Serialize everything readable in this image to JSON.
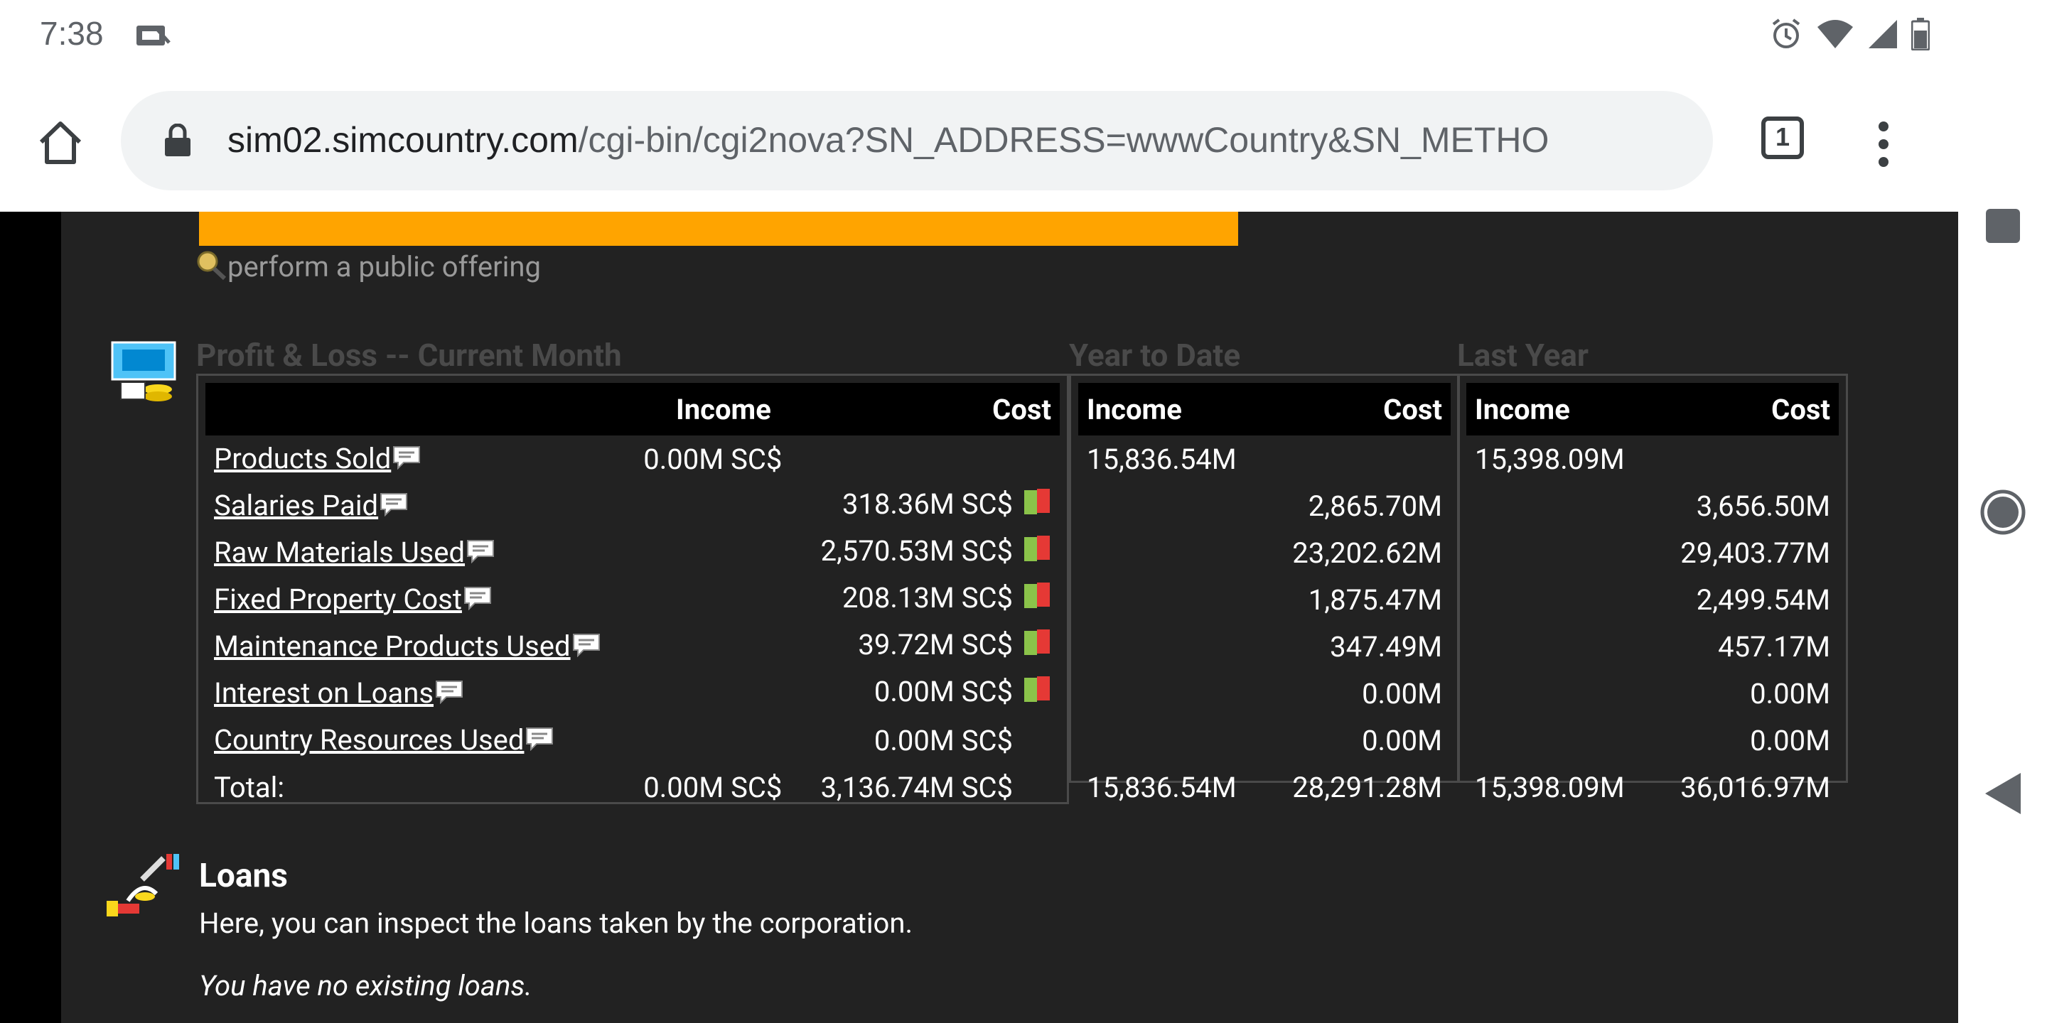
{
  "status": {
    "time": "7:38"
  },
  "browser": {
    "url_host": "sim02.simcountry.com",
    "url_path": "/cgi-bin/cgi2nova?SN_ADDRESS=wwwCountry&SN_METHO",
    "tab_count": "1"
  },
  "offer": {
    "text": "perform a public offering"
  },
  "pl": {
    "current_title": "Profit & Loss -- Current Month",
    "ytd_title": "Year to Date",
    "ly_title": "Last Year",
    "headers": {
      "income": "Income",
      "cost": "Cost"
    },
    "rows": [
      {
        "label": "Products Sold",
        "cur_income": "0.00M SC$",
        "cur_cost": "",
        "ytd_income": "15,836.54M",
        "ytd_cost": "",
        "ly_income": "15,398.09M",
        "ly_cost": ""
      },
      {
        "label": "Salaries Paid",
        "cur_income": "",
        "cur_cost": "318.36M SC$",
        "ytd_income": "",
        "ytd_cost": "2,865.70M",
        "ly_income": "",
        "ly_cost": "3,656.50M"
      },
      {
        "label": "Raw Materials Used",
        "cur_income": "",
        "cur_cost": "2,570.53M SC$",
        "ytd_income": "",
        "ytd_cost": "23,202.62M",
        "ly_income": "",
        "ly_cost": "29,403.77M"
      },
      {
        "label": "Fixed Property Cost",
        "cur_income": "",
        "cur_cost": "208.13M SC$",
        "ytd_income": "",
        "ytd_cost": "1,875.47M",
        "ly_income": "",
        "ly_cost": "2,499.54M"
      },
      {
        "label": "Maintenance Products Used",
        "cur_income": "",
        "cur_cost": "39.72M SC$",
        "ytd_income": "",
        "ytd_cost": "347.49M",
        "ly_income": "",
        "ly_cost": "457.17M"
      },
      {
        "label": "Interest on Loans",
        "cur_income": "",
        "cur_cost": "0.00M SC$",
        "ytd_income": "",
        "ytd_cost": "0.00M",
        "ly_income": "",
        "ly_cost": "0.00M"
      },
      {
        "label": "Country Resources Used",
        "cur_income": "",
        "cur_cost": "0.00M SC$",
        "ytd_income": "",
        "ytd_cost": "0.00M",
        "ly_income": "",
        "ly_cost": "0.00M"
      }
    ],
    "total": {
      "label": "Total:",
      "cur_income": "0.00M SC$",
      "cur_cost": "3,136.74M SC$",
      "ytd_income": "15,836.54M",
      "ytd_cost": "28,291.28M",
      "ly_income": "15,398.09M",
      "ly_cost": "36,016.97M"
    }
  },
  "loans": {
    "title": "Loans",
    "desc": "Here, you can inspect the loans taken by the corporation.",
    "none": "You have no existing loans."
  }
}
